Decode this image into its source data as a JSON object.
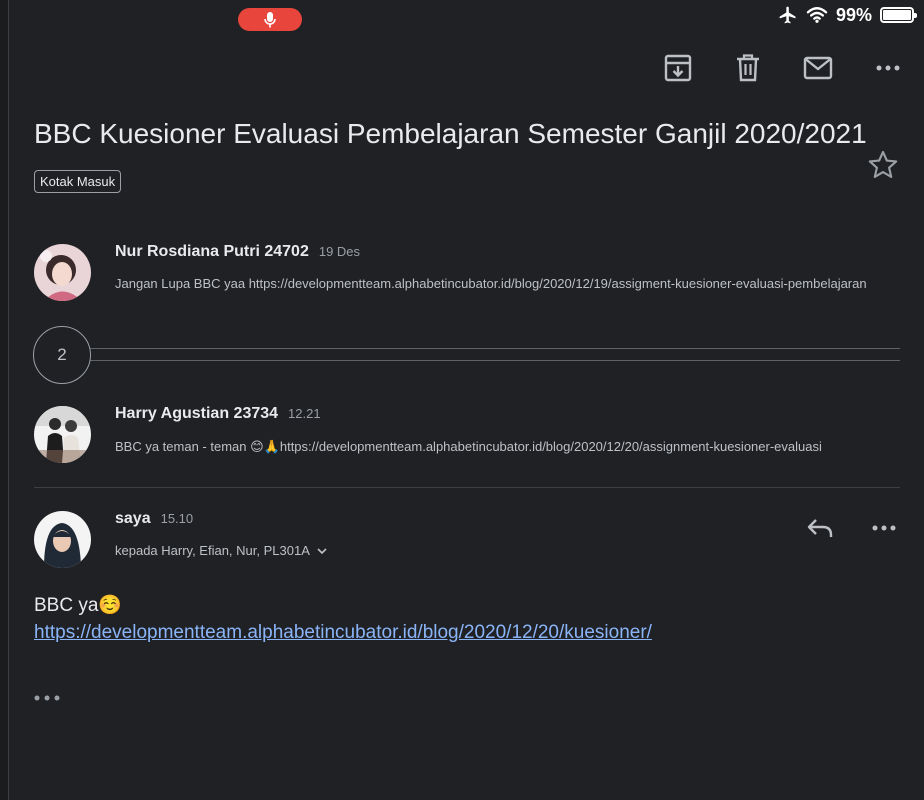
{
  "status_bar": {
    "battery_percent": "99%",
    "battery_level": 0.99,
    "mic_color": "#e8453c"
  },
  "toolbar": {
    "icons": [
      "archive-icon",
      "trash-icon",
      "mark-unread-icon",
      "more-icon"
    ]
  },
  "email": {
    "subject": "BBC Kuesioner Evaluasi Pembelajaran Semester Ganjil 2020/2021",
    "label": "Kotak Masuk",
    "collapsed_count": "2"
  },
  "messages": [
    {
      "sender": "Nur Rosdiana Putri 24702",
      "time": "19 Des",
      "snippet": "Jangan Lupa BBC yaa https://developmentteam.alphabetincubator.id/blog/2020/12/19/assigment-kuesioner-evaluasi-pembelajaran"
    },
    {
      "sender": "Harry Agustian 23734",
      "time": "12.21",
      "snippet": "BBC ya teman - teman 😊🙏https://developmentteam.alphabetincubator.id/blog/2020/12/20/assignment-kuesioner-evaluasi"
    },
    {
      "sender": "saya",
      "time": "15.10",
      "recipients": "kepada Harry, Efian, Nur, PL301A",
      "body_text": "BBC ya☺️",
      "body_link": "https://developmentteam.alphabetincubator.id/blog/2020/12/20/kuesioner/"
    }
  ],
  "colors": {
    "background": "#202124",
    "link": "#8ab4f8",
    "muted": "#9aa0a6"
  }
}
